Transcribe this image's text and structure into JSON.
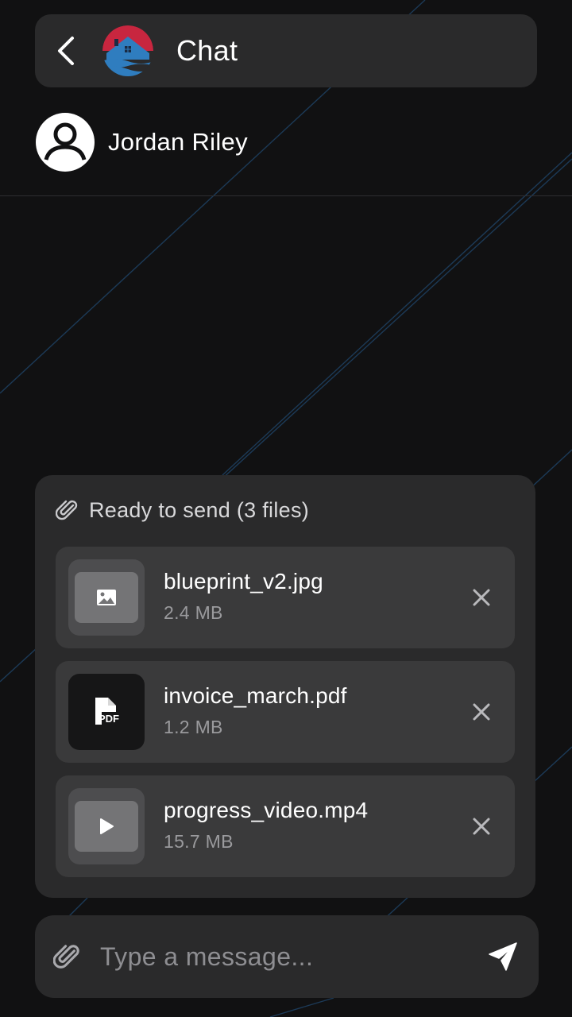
{
  "header": {
    "title": "Chat",
    "back_icon": "chevron-left-icon",
    "logo": "house-on-waves-logo"
  },
  "contact": {
    "name": "Jordan Riley",
    "avatar_icon": "user-avatar-icon"
  },
  "attachments": {
    "heading": "Ready to send (3 files)",
    "heading_icon": "paperclip-icon",
    "files": [
      {
        "name": "blueprint_v2.jpg",
        "size": "2.4 MB",
        "type_icon": "image-icon"
      },
      {
        "name": "invoice_march.pdf",
        "size": "1.2 MB",
        "type_icon": "pdf-file-icon"
      },
      {
        "name": "progress_video.mp4",
        "size": "15.7 MB",
        "type_icon": "play-icon"
      }
    ],
    "remove_icon": "close-icon"
  },
  "composer": {
    "placeholder": "Type a message...",
    "value": "",
    "attach_icon": "paperclip-icon",
    "send_icon": "send-icon"
  },
  "colors": {
    "background": "#111112",
    "surface": "#2a2a2b",
    "file_row": "#3a3a3b",
    "accent_line": "#1d3a55",
    "logo_red": "#c8263f",
    "logo_blue": "#2f7dbf"
  }
}
